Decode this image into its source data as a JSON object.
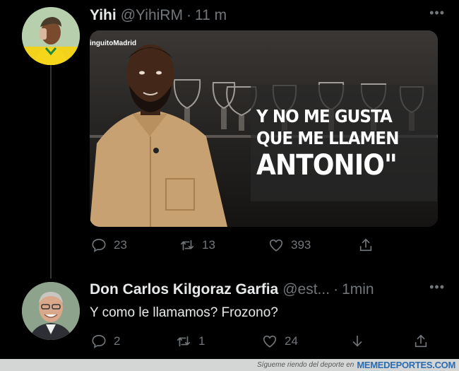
{
  "tweets": [
    {
      "name": "Yihi",
      "handle": "@YihiRM",
      "time": "11 m",
      "media": {
        "watermark": "inguitoMadrid",
        "caption": [
          "Y NO ME GUSTA",
          "QUE ME LLAMEN",
          "ANTONIO\""
        ]
      },
      "stats": {
        "replies": "23",
        "retweets": "13",
        "likes": "393"
      }
    },
    {
      "name": "Don Carlos Kilgoraz Garfia",
      "handle": "@est...",
      "time": "1min",
      "text": "Y como le llamamos? Frozono?",
      "stats": {
        "replies": "2",
        "retweets": "1",
        "likes": "24"
      }
    }
  ],
  "footer": {
    "tagline": "Sígueте riendo del deporte en",
    "site": "MEMEDEPORTES.COM"
  },
  "colors": {
    "background": "#000000",
    "text": "#e7e9ea",
    "muted": "#71767b",
    "thread_line": "#333639",
    "footer_bg": "#d4d6d5",
    "footer_link": "#2b6bb0"
  }
}
